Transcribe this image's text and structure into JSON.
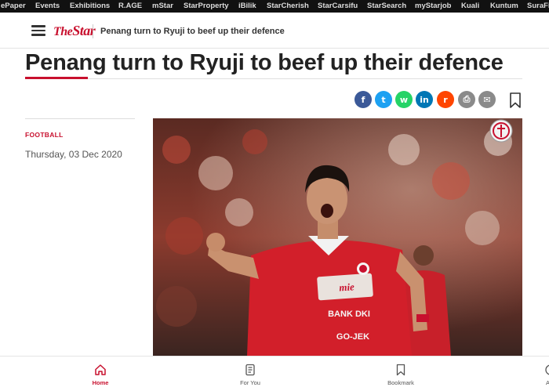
{
  "topbar": {
    "links": [
      "ePaper",
      "Events",
      "Exhibitions",
      "R.AGE",
      "mStar",
      "StarProperty",
      "iBilik",
      "StarCherish",
      "StarCarsifu",
      "StarSearch",
      "myStarjob",
      "Kuali",
      "Kuntum",
      "SuraFi"
    ]
  },
  "header": {
    "logo_prefix": "The",
    "logo_word": "Star",
    "title": "Penang turn to Ryuji to beef up their defence"
  },
  "article": {
    "headline": "Penang turn to Ryuji to beef up their defence",
    "category": "FOOTBALL",
    "date": "Thursday, 03 Dec 2020"
  },
  "share": {
    "icons": [
      "facebook-icon",
      "twitter-icon",
      "whatsapp-icon",
      "linkedin-icon",
      "reddit-icon",
      "print-icon",
      "email-icon"
    ],
    "glyphs": [
      "f",
      "t",
      "w",
      "in",
      "r",
      "⎙",
      "✉"
    ],
    "colors": [
      "#3b5998",
      "#1da1f2",
      "#25d366",
      "#0077b5",
      "#ff4500",
      "#8a8a8a",
      "#8a8a8a"
    ]
  },
  "photo": {
    "jersey_sponsor_line1": "BANK DKI",
    "jersey_sponsor_line2": "GO-JEK"
  },
  "bottomnav": {
    "items": [
      {
        "label": "Home",
        "icon": "home-icon",
        "active": true
      },
      {
        "label": "For You",
        "icon": "for-you-icon",
        "active": false
      },
      {
        "label": "Bookmark",
        "icon": "bookmark-icon",
        "active": false
      },
      {
        "label": "A",
        "icon": "audio-icon",
        "active": false
      }
    ]
  },
  "colors": {
    "brand_red": "#c8102e",
    "topbar_bg": "#111111"
  }
}
